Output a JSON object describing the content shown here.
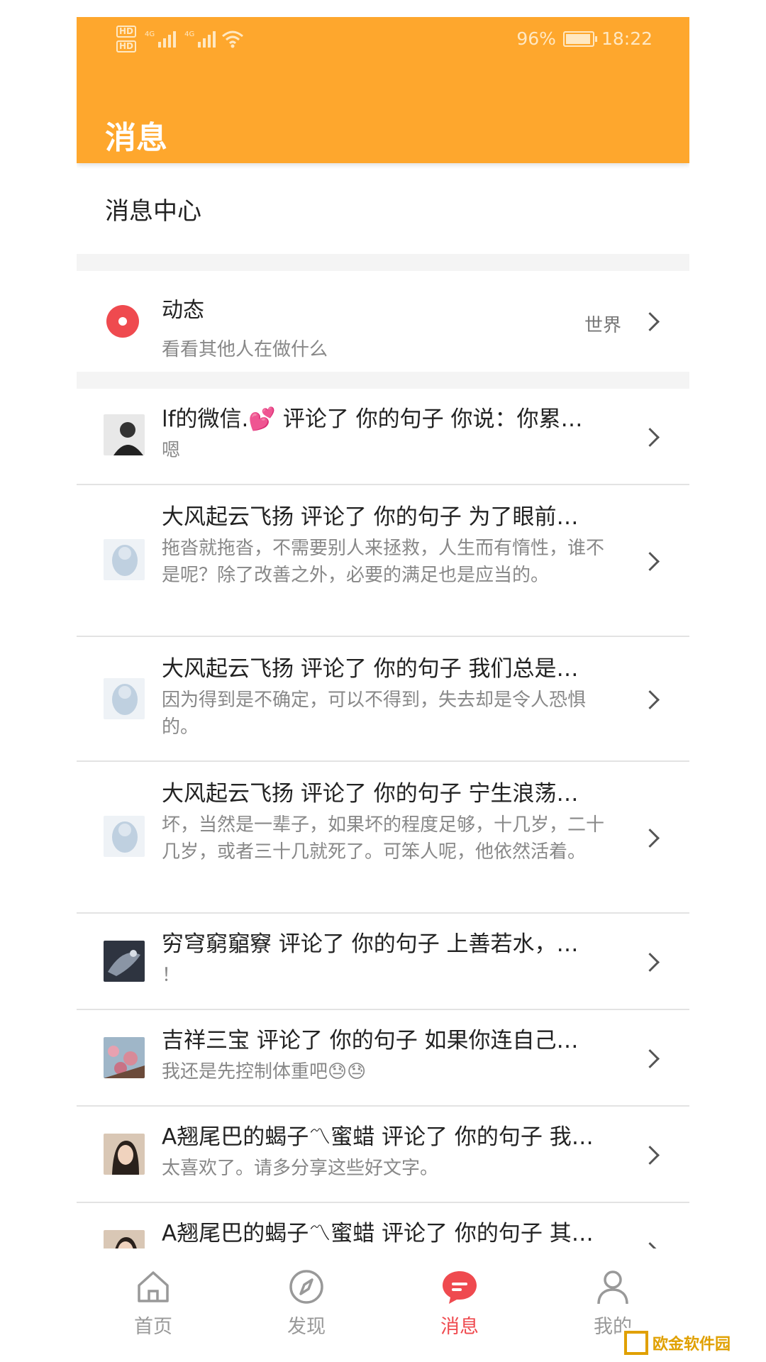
{
  "status_bar": {
    "battery": "96%",
    "time": "18:22",
    "network": "4G"
  },
  "header": {
    "title": "消息"
  },
  "section": {
    "title": "消息中心"
  },
  "feed": {
    "title": "动态",
    "subtitle": "看看其他人在做什么",
    "right_label": "世界"
  },
  "messages": [
    {
      "title": "lf的微信.💕 评论了 你的句子 你说：你累…",
      "text": "嗯"
    },
    {
      "title": "大风起云飞扬 评论了 你的句子 为了眼前…",
      "text": "拖沓就拖沓，不需要别人来拯救，人生而有惰性，谁不是呢？除了改善之外，必要的满足也是应当的。"
    },
    {
      "title": "大风起云飞扬 评论了 你的句子 我们总是…",
      "text": "因为得到是不确定，可以不得到，失去却是令人恐惧的。"
    },
    {
      "title": "大风起云飞扬 评论了 你的句子 宁生浪荡…",
      "text": "坏，当然是一辈子，如果坏的程度足够，十几岁，二十几岁，或者三十几就死了。可笨人呢，他依然活着。"
    },
    {
      "title": "穷穹窮竆竂 评论了 你的句子 上善若水，…",
      "text": "！"
    },
    {
      "title": "吉祥三宝 评论了 你的句子 如果你连自己…",
      "text": "我还是先控制体重吧😓😓"
    },
    {
      "title": "A翘尾巴的蝎子〽蜜蜡 评论了 你的句子 我…",
      "text": "太喜欢了。请多分享这些好文字。"
    },
    {
      "title": "A翘尾巴的蝎子〽蜜蜡 评论了 你的句子 其…",
      "text": ""
    }
  ],
  "tabbar": {
    "home": "首页",
    "discover": "发现",
    "messages": "消息",
    "mine": "我的"
  },
  "watermark": "欧金软件园",
  "colors": {
    "accent": "#FEA72D",
    "active_tab": "#EF4A4F",
    "feed_icon": "#EF4A4F"
  }
}
